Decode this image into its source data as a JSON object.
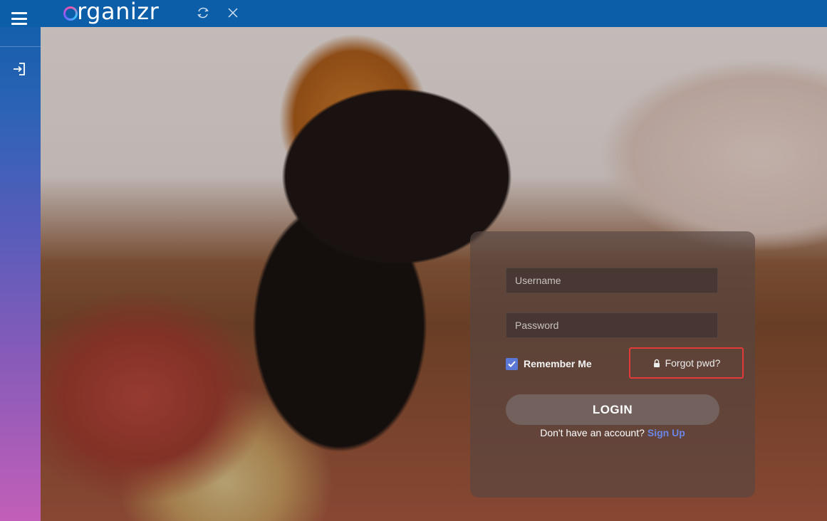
{
  "app": {
    "logo_text": "rganizr",
    "brand_color": "#0d5ea8"
  },
  "topbar": {
    "menu_icon": "hamburger-icon",
    "refresh_icon": "refresh-icon",
    "close_icon": "close-icon"
  },
  "sidebar": {
    "items": [
      {
        "icon": "login-icon"
      }
    ]
  },
  "login": {
    "username_placeholder": "Username",
    "password_placeholder": "Password",
    "remember_label": "Remember Me",
    "remember_checked": true,
    "forgot_label": "Forgot pwd?",
    "forgot_icon": "lock-icon",
    "login_button": "LOGIN",
    "signup_prompt": "Don't have an account?",
    "signup_link": "Sign Up",
    "accent_color": "#6b86e6",
    "highlight_color": "#e23a3a"
  }
}
